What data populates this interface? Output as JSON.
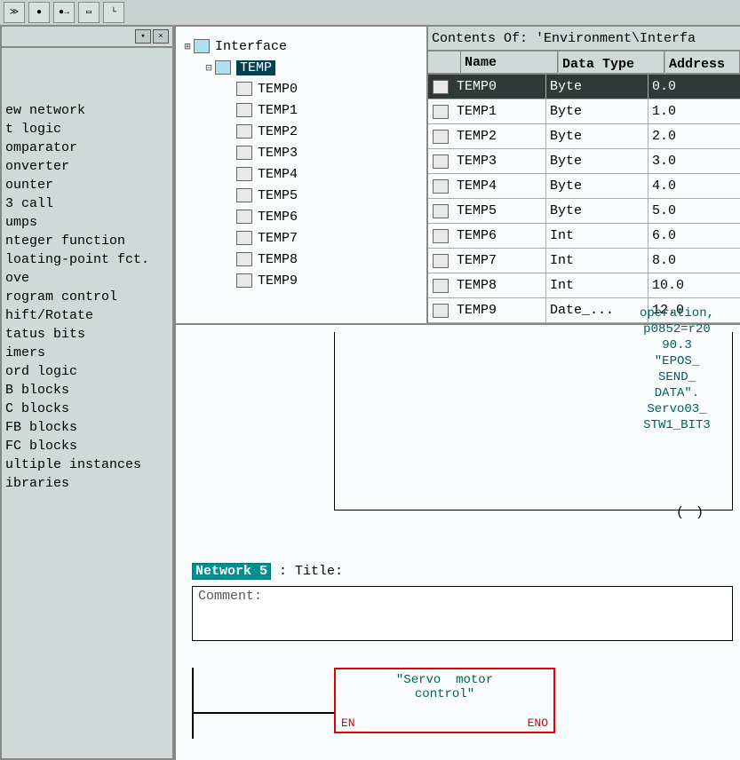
{
  "categories": [
    "ew network",
    "t logic",
    "omparator",
    "onverter",
    "ounter",
    "3 call",
    "umps",
    "nteger function",
    "loating-point fct.",
    "ove",
    "rogram control",
    "hift/Rotate",
    "tatus bits",
    "imers",
    "ord logic",
    "B blocks",
    "C blocks",
    "FB blocks",
    "FC blocks",
    "ultiple instances",
    "ibraries"
  ],
  "tree": {
    "root": "Interface",
    "folder": "TEMP",
    "vars": [
      "TEMP0",
      "TEMP1",
      "TEMP2",
      "TEMP3",
      "TEMP4",
      "TEMP5",
      "TEMP6",
      "TEMP7",
      "TEMP8",
      "TEMP9"
    ]
  },
  "table": {
    "title": "Contents Of: 'Environment\\Interfa",
    "headers": {
      "name": "Name",
      "type": "Data Type",
      "addr": "Address"
    },
    "rows": [
      {
        "name": "TEMP0",
        "type": "Byte",
        "addr": "0.0",
        "sel": true
      },
      {
        "name": "TEMP1",
        "type": "Byte",
        "addr": "1.0"
      },
      {
        "name": "TEMP2",
        "type": "Byte",
        "addr": "2.0"
      },
      {
        "name": "TEMP3",
        "type": "Byte",
        "addr": "3.0"
      },
      {
        "name": "TEMP4",
        "type": "Byte",
        "addr": "4.0"
      },
      {
        "name": "TEMP5",
        "type": "Byte",
        "addr": "5.0"
      },
      {
        "name": "TEMP6",
        "type": "Int",
        "addr": "6.0"
      },
      {
        "name": "TEMP7",
        "type": "Int",
        "addr": "8.0"
      },
      {
        "name": "TEMP8",
        "type": "Int",
        "addr": "10.0"
      },
      {
        "name": "TEMP9",
        "type": "Date_...",
        "addr": "12.0"
      }
    ]
  },
  "ladder": {
    "coil_lines": [
      "operation,",
      "p0852=r20",
      "90.3",
      "\"EPOS_",
      "SEND_",
      "DATA\".",
      "Servo03_",
      "STW1_BIT3"
    ],
    "coil_symbol": "( )",
    "network_label": "Network 5",
    "title_prefix": ": Title:",
    "comment_label": "Comment:",
    "fb_title": "\"Servo  motor\ncontrol\"",
    "en": "EN",
    "eno": "ENO"
  }
}
